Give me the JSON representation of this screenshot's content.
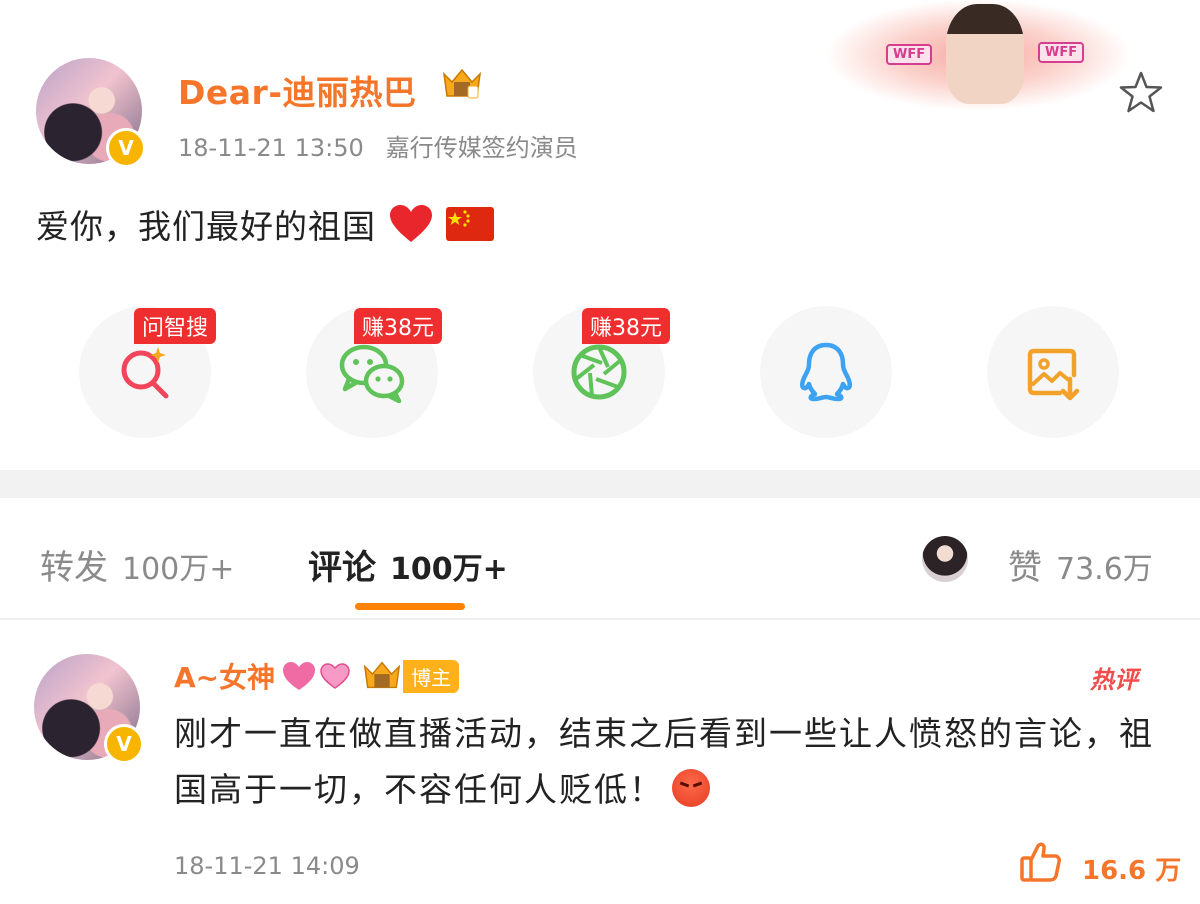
{
  "post": {
    "username": "Dear-迪丽热巴",
    "time": "18-11-21 13:50",
    "source": "嘉行传媒签约演员",
    "text": "爱你，我们最好的祖国",
    "verified_badge": "V",
    "banner_text": "WFF"
  },
  "share": [
    {
      "name": "wenzhisou",
      "badge": "问智搜",
      "icon": "search-sparkle-icon",
      "color": "#f0455a"
    },
    {
      "name": "wechat",
      "badge": "赚38元",
      "icon": "wechat-icon",
      "color": "#5fc35a"
    },
    {
      "name": "moments",
      "badge": "赚38元",
      "icon": "moments-icon",
      "color": "#5fc35a"
    },
    {
      "name": "qq",
      "badge": "",
      "icon": "qq-icon",
      "color": "#3ea2f2"
    },
    {
      "name": "save-image",
      "badge": "",
      "icon": "save-image-icon",
      "color": "#f2a22b"
    }
  ],
  "tabs": {
    "repost_label": "转发",
    "repost_count": "100万+",
    "comment_label": "评论",
    "comment_count": "100万+",
    "like_label": "赞",
    "like_count": "73.6万"
  },
  "comment": {
    "username": "A~女神",
    "badge": "博主",
    "hot_label": "热评",
    "text": "刚才一直在做直播活动，结束之后看到一些让人愤怒的言论，祖国高于一切，不容任何人贬低！",
    "time": "18-11-21 14:09",
    "likes": "16.6 万"
  },
  "colors": {
    "accent_orange": "#f5762b",
    "tab_underline": "#ff8200",
    "badge_red": "#ef2f2f"
  }
}
